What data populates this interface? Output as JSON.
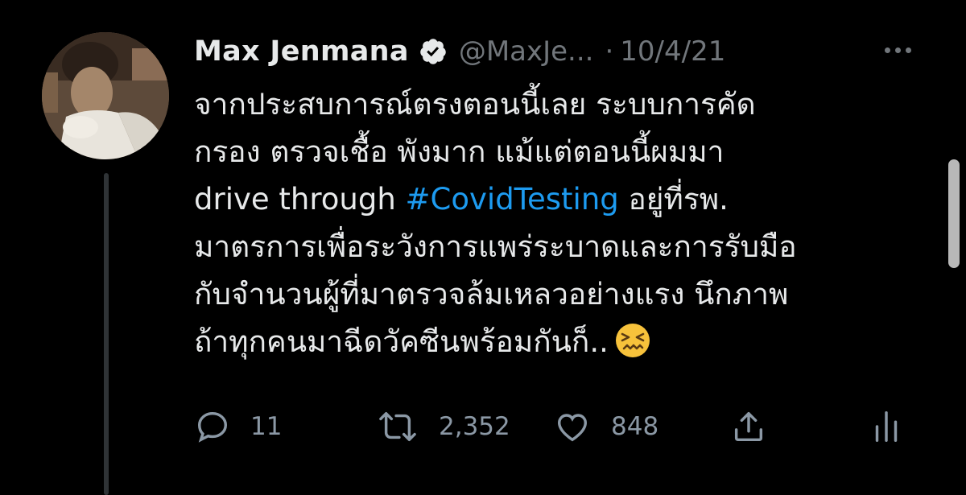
{
  "tweet": {
    "author_name": "Max Jenmana",
    "handle": "@MaxJe...",
    "separator": "·",
    "date": "10/4/21",
    "text_lines": {
      "l1": "จากประสบการณ์ตรงตอนนี้เลย ระบบการคัด",
      "l2": "กรอง ตรวจเชื้อ พังมาก แม้แต่ตอนนี้ผมมา",
      "l3_pre": "drive through ",
      "l3_tag": "#CovidTesting",
      "l3_post": " อยู่ที่รพ.",
      "l4": "มาตรการเพื่อระวังการแพร่ระบาดและการรับมือ",
      "l5": "กับจำนวนผู้ที่มาตรวจล้มเหลวอย่างแรง นึกภาพ",
      "l6": "ถ้าทุกคนมาฉีดวัคซีนพร้อมกันก็.."
    },
    "emoji": "confounded-face",
    "stats": {
      "replies": "11",
      "retweets": "2,352",
      "likes": "848"
    }
  },
  "colors": {
    "background": "#000000",
    "text": "#e7e9ea",
    "muted": "#71767b",
    "link": "#1d9bf0",
    "verified_badge": "#e7e9ea"
  }
}
